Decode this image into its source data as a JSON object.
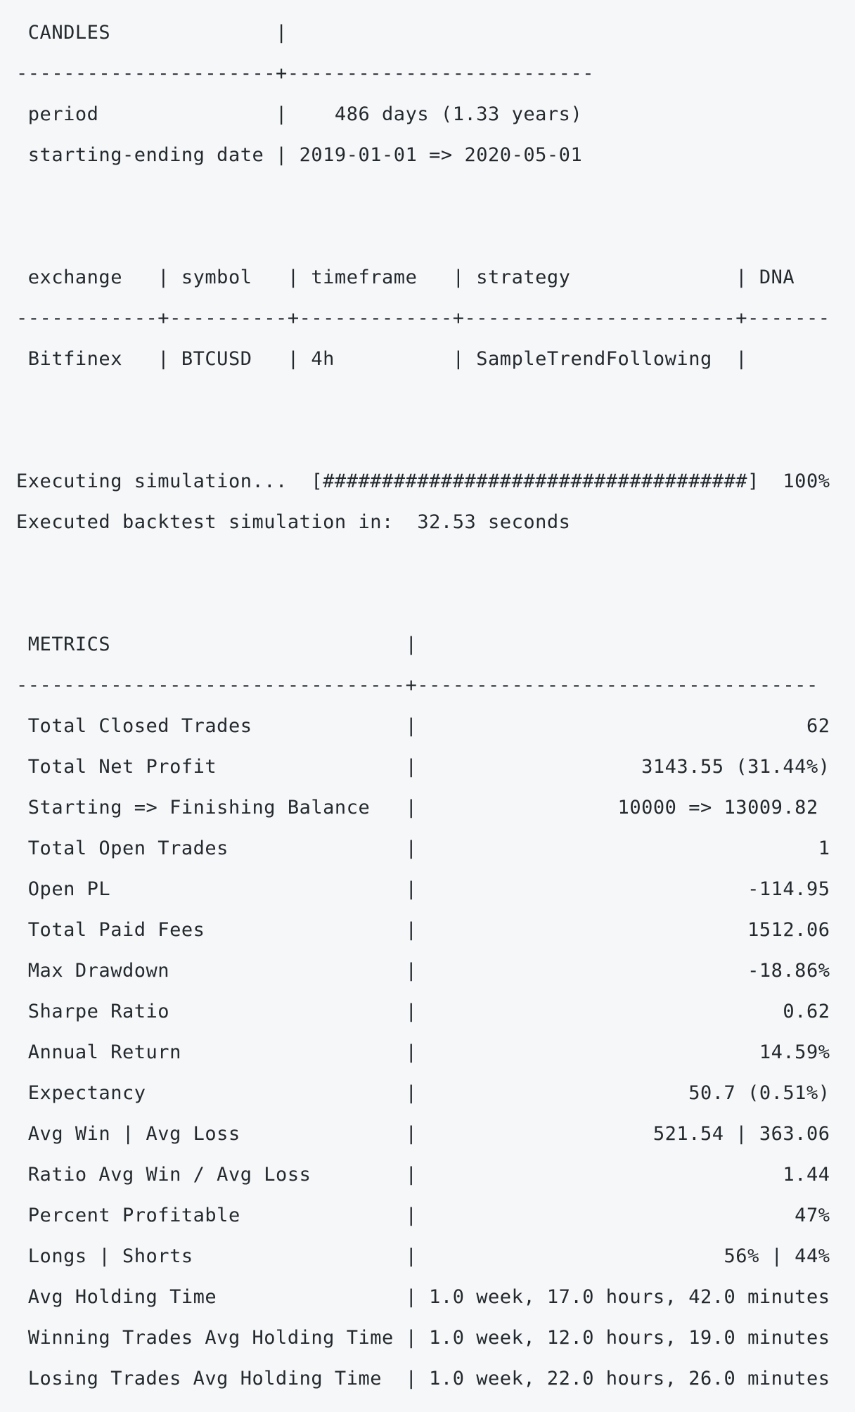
{
  "candles": {
    "header": " CANDLES              |",
    "separator": "----------------------+--------------------------",
    "rows": [
      " period               |    486 days (1.33 years)",
      " starting-ending date | 2019-01-01 => 2020-05-01"
    ]
  },
  "routes": {
    "header": " exchange   | symbol   | timeframe   | strategy              | DNA",
    "separator": "------------+----------+-------------+-----------------------+-------",
    "rows": [
      " Bitfinex   | BTCUSD   | 4h          | SampleTrendFollowing  |"
    ]
  },
  "simulation": {
    "executing": "Executing simulation...  [####################################]  100%",
    "executed": "Executed backtest simulation in:  32.53 seconds",
    "progress_percent": 100
  },
  "metrics": {
    "header": " METRICS                         |",
    "separator": "---------------------------------+----------------------------------",
    "rows": [
      " Total Closed Trades             |                                 62",
      " Total Net Profit                |                   3143.55 (31.44%)",
      " Starting => Finishing Balance   |                 10000 => 13009.82",
      " Total Open Trades               |                                  1",
      " Open PL                         |                            -114.95",
      " Total Paid Fees                 |                            1512.06",
      " Max Drawdown                    |                            -18.86%",
      " Sharpe Ratio                    |                               0.62",
      " Annual Return                   |                             14.59%",
      " Expectancy                      |                       50.7 (0.51%)",
      " Avg Win | Avg Loss              |                    521.54 | 363.06",
      " Ratio Avg Win / Avg Loss        |                               1.44",
      " Percent Profitable              |                                47%",
      " Longs | Shorts                  |                          56% | 44%",
      " Avg Holding Time                | 1.0 week, 17.0 hours, 42.0 minutes",
      " Winning Trades Avg Holding Time | 1.0 week, 12.0 hours, 19.0 minutes",
      " Losing Trades Avg Holding Time  | 1.0 week, 22.0 hours, 26.0 minutes"
    ]
  }
}
